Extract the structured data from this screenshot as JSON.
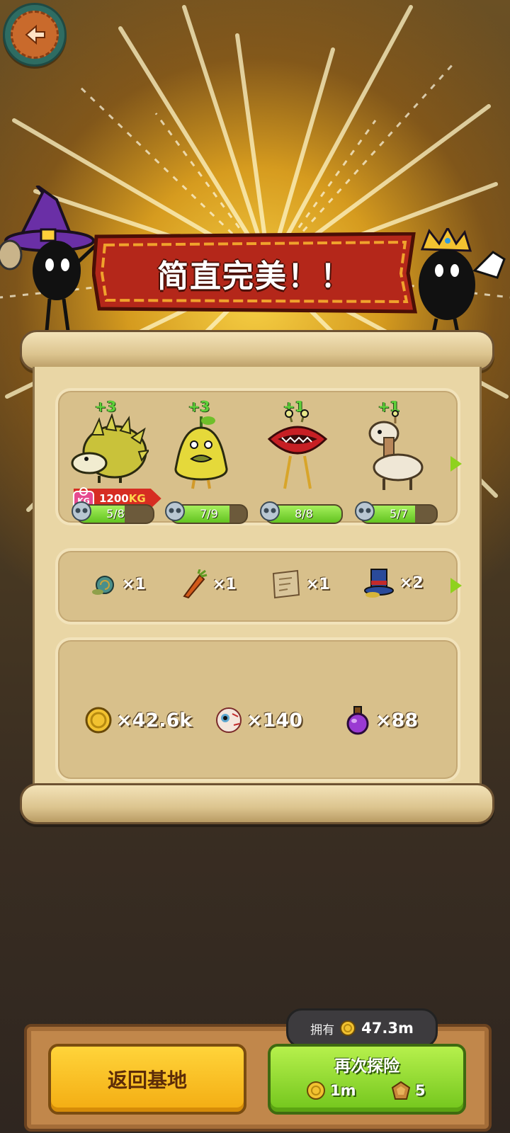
{
  "banner": {
    "title": "简直完美！！"
  },
  "creatures": [
    {
      "name": "hedgehog",
      "bonus": "+3",
      "progress_text": "5/8",
      "progress": 0.625,
      "weight_value": "1200",
      "weight_unit": "KG"
    },
    {
      "name": "pear-bird",
      "bonus": "+3",
      "progress_text": "7/9",
      "progress": 0.778
    },
    {
      "name": "lips-monster",
      "bonus": "+1",
      "progress_text": "8/8",
      "progress": 1.0
    },
    {
      "name": "alpaca",
      "bonus": "+1",
      "progress_text": "5/7",
      "progress": 0.714
    }
  ],
  "items": [
    {
      "icon": "snail-icon",
      "count": "×1"
    },
    {
      "icon": "carrot-icon",
      "count": "×1"
    },
    {
      "icon": "map-scroll-icon",
      "count": "×1"
    },
    {
      "icon": "top-hat-icon",
      "count": "×2"
    }
  ],
  "resources": [
    {
      "icon": "coin-icon",
      "count": "×42.6k"
    },
    {
      "icon": "eyeball-icon",
      "count": "×140"
    },
    {
      "icon": "potion-icon",
      "count": "×88"
    }
  ],
  "owned": {
    "label": "拥有",
    "value": "47.3m"
  },
  "buttons": {
    "return_label": "返回基地",
    "again_label": "再次探险",
    "again_coin_cost": "1m",
    "again_gem_cost": "5"
  },
  "colors": {
    "accent_green": "#72c51c",
    "accent_yellow": "#f3ac12",
    "banner_red": "#b4271a",
    "progress_green": "#62c320"
  }
}
